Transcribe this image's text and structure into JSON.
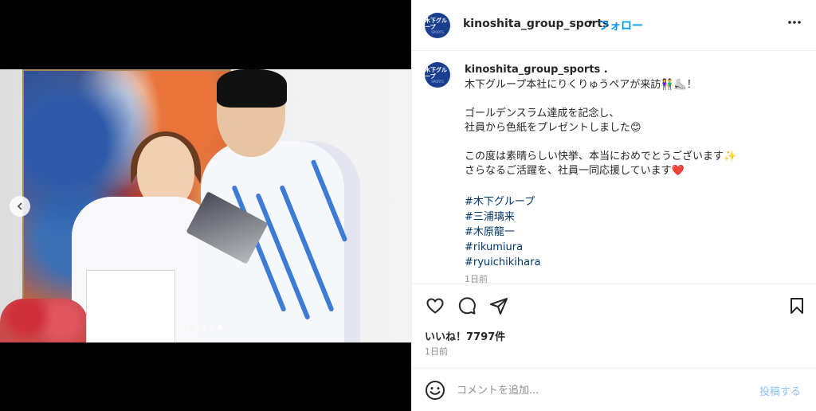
{
  "post": {
    "username": "kinoshita_group_sports",
    "separator": "•",
    "follow_label": "フォロー",
    "more_label": "•••",
    "avatar_text": "木下グループ",
    "avatar_sub": "SPORTS"
  },
  "caption": {
    "username": "kinoshita_group_sports .",
    "body": "木下グループ本社にりくりゅうペアが来訪👫⛸️！\n\nゴールデンスラム達成を記念し、\n社員から色紙をプレゼントしました😊\n\nこの度は素晴らしい快挙、本当におめでとうございます✨\nさらなるご活躍を、社員一同応援しています❤️",
    "hashtags": [
      "#木下グループ",
      "#三浦璃来",
      "#木原龍一",
      "#rikumiura",
      "#ryuichikihara"
    ],
    "time": "1日前"
  },
  "media": {
    "carousel_dots": 5,
    "active_dot": 4,
    "prev_icon": "chevron-left-icon"
  },
  "actions": {
    "icons": [
      "heart-icon",
      "comment-icon",
      "share-icon",
      "bookmark-icon"
    ]
  },
  "likes": "いいね！7797件",
  "post_time": "1日前",
  "comment": {
    "placeholder": "コメントを追加...",
    "post_label": "投稿する",
    "emoji_icon": "smiley-icon"
  },
  "colors": {
    "accent": "#0095f6",
    "post_disabled": "#8ec4f6",
    "hashtag": "#00376b",
    "avatar_bg": "#1b3f8f"
  }
}
